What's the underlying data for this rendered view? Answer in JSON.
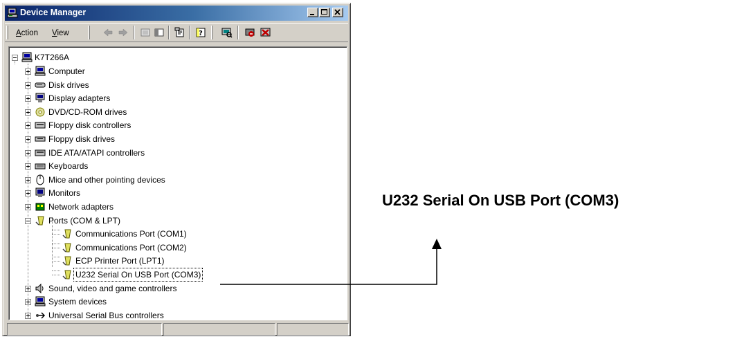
{
  "window": {
    "title": "Device Manager",
    "icon": "device-manager-icon",
    "controls": [
      "minimize-icon",
      "maximize-icon",
      "close-icon"
    ]
  },
  "menu": {
    "items": [
      "Action",
      "View"
    ]
  },
  "toolbar": {
    "buttons": [
      "back-arrow-icon",
      "forward-arrow-icon",
      "view-tree-icon",
      "console-tree-icon",
      "properties-icon",
      "help-icon",
      "scan-hardware-icon",
      "uninstall-icon",
      "disable-icon"
    ]
  },
  "tree": {
    "root": "K7T266A",
    "categories": [
      {
        "label": "Computer",
        "icon": "computer-icon"
      },
      {
        "label": "Disk drives",
        "icon": "disk-drive-icon"
      },
      {
        "label": "Display adapters",
        "icon": "display-adapter-icon"
      },
      {
        "label": "DVD/CD-ROM drives",
        "icon": "cdrom-icon"
      },
      {
        "label": "Floppy disk controllers",
        "icon": "floppy-controller-icon"
      },
      {
        "label": "Floppy disk drives",
        "icon": "floppy-drive-icon"
      },
      {
        "label": "IDE ATA/ATAPI controllers",
        "icon": "ide-controller-icon"
      },
      {
        "label": "Keyboards",
        "icon": "keyboard-icon"
      },
      {
        "label": "Mice and other pointing devices",
        "icon": "mouse-icon"
      },
      {
        "label": "Monitors",
        "icon": "monitor-icon"
      },
      {
        "label": "Network adapters",
        "icon": "network-adapter-icon"
      },
      {
        "label": "Ports (COM & LPT)",
        "icon": "port-icon"
      }
    ],
    "ports": [
      {
        "label": "Communications Port (COM1)",
        "icon": "port-icon"
      },
      {
        "label": "Communications Port (COM2)",
        "icon": "port-icon"
      },
      {
        "label": "ECP Printer Port (LPT1)",
        "icon": "port-icon"
      },
      {
        "label": "U232 Serial On USB Port (COM3)",
        "icon": "port-icon"
      }
    ],
    "after": [
      {
        "label": "Sound, video and game controllers",
        "icon": "speaker-icon"
      },
      {
        "label": "System devices",
        "icon": "computer-icon"
      },
      {
        "label": "Universal Serial Bus controllers",
        "icon": "usb-icon"
      }
    ]
  },
  "callout": {
    "text": "U232 Serial On USB Port (COM3)"
  },
  "colors": {
    "title_gradient_start": "#0a246a",
    "title_gradient_end": "#a6caf0",
    "window_face": "#d4d0c8"
  }
}
